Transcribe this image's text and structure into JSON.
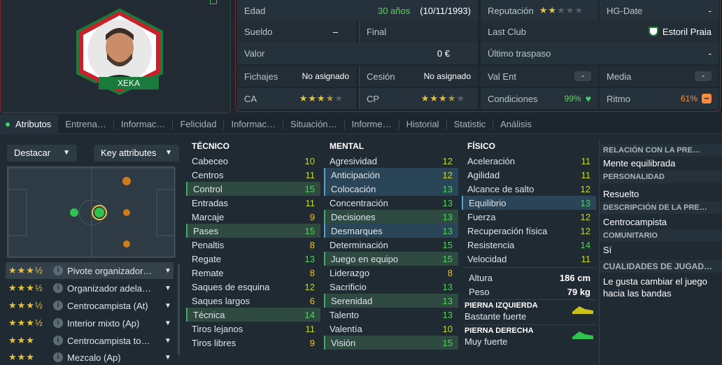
{
  "player": {
    "name": "XEKA"
  },
  "info": {
    "edad_label": "Edad",
    "edad_value": "30 años",
    "birth_date": "(10/11/1993)",
    "reputacion_label": "Reputación",
    "reputacion_stars": "★★☆☆☆",
    "hg_label": "HG-Date",
    "hg_value": "-",
    "sueldo_label": "Sueldo",
    "sueldo_value": "–",
    "final_label": "Final",
    "last_club_label": "Last Club",
    "last_club_value": "Estoril Praia",
    "valor_label": "Valor",
    "valor_value": "0 €",
    "ultimo_label": "Último traspaso",
    "ultimo_value": "-",
    "fichajes_label": "Fichajes",
    "fichajes_value": "No asignado",
    "cesion_label": "Cesión",
    "cesion_value": "No asignado",
    "valent_label": "Val Ent",
    "valent_value": "-",
    "media_label": "Media",
    "media_value": "-",
    "ca_label": "CA",
    "ca_stars": 3.5,
    "cp_label": "CP",
    "cp_stars": 3.5,
    "condiciones_label": "Condiciones",
    "condiciones_value": "99%",
    "ritmo_label": "Ritmo",
    "ritmo_value": "61%",
    "colors": {
      "green": "#5fd35a",
      "orange": "#ff8b3a",
      "accent_red": "#7a2530"
    }
  },
  "tabs": [
    "Atributos",
    "Entrena…",
    "Informac…",
    "Felicidad",
    "Informac…",
    "Situación…",
    "Informe…",
    "Historial",
    "Statistic",
    "Análisis"
  ],
  "left": {
    "destacar": "Destacar",
    "key_attributes": "Key attributes",
    "roles": [
      {
        "stars": "★★★½",
        "name": "Pivote organizador…"
      },
      {
        "stars": "★★★½",
        "name": "Organizador adela…"
      },
      {
        "stars": "★★★½",
        "name": "Centrocampista (At)"
      },
      {
        "stars": "★★★½",
        "name": "Interior mixto (Ap)"
      },
      {
        "stars": "★★★",
        "name": "Centrocampista to…"
      },
      {
        "stars": "★★★",
        "name": "Mezcalo (Ap)"
      }
    ]
  },
  "tecnico": {
    "title": "TÉCNICO",
    "attrs": [
      {
        "n": "Cabeceo",
        "v": "10",
        "hl": ""
      },
      {
        "n": "Centros",
        "v": "11",
        "hl": ""
      },
      {
        "n": "Control",
        "v": "15",
        "hl": "green"
      },
      {
        "n": "Entradas",
        "v": "11",
        "hl": ""
      },
      {
        "n": "Marcaje",
        "v": "9",
        "hl": ""
      },
      {
        "n": "Pases",
        "v": "15",
        "hl": "green"
      },
      {
        "n": "Penaltis",
        "v": "8",
        "hl": ""
      },
      {
        "n": "Regate",
        "v": "13",
        "hl": ""
      },
      {
        "n": "Remate",
        "v": "8",
        "hl": ""
      },
      {
        "n": "Saques de esquina",
        "v": "12",
        "hl": ""
      },
      {
        "n": "Saques largos",
        "v": "6",
        "hl": ""
      },
      {
        "n": "Técnica",
        "v": "14",
        "hl": "green"
      },
      {
        "n": "Tiros lejanos",
        "v": "11",
        "hl": ""
      },
      {
        "n": "Tiros libres",
        "v": "9",
        "hl": ""
      }
    ]
  },
  "mental": {
    "title": "MENTAL",
    "attrs": [
      {
        "n": "Agresividad",
        "v": "12",
        "hl": ""
      },
      {
        "n": "Anticipación",
        "v": "12",
        "hl": "blue"
      },
      {
        "n": "Colocación",
        "v": "13",
        "hl": "blue"
      },
      {
        "n": "Concentración",
        "v": "13",
        "hl": ""
      },
      {
        "n": "Decisiones",
        "v": "13",
        "hl": "green"
      },
      {
        "n": "Desmarques",
        "v": "13",
        "hl": "blue"
      },
      {
        "n": "Determinación",
        "v": "15",
        "hl": ""
      },
      {
        "n": "Juego en equipo",
        "v": "15",
        "hl": "green"
      },
      {
        "n": "Liderazgo",
        "v": "8",
        "hl": ""
      },
      {
        "n": "Sacrificio",
        "v": "13",
        "hl": ""
      },
      {
        "n": "Serenidad",
        "v": "13",
        "hl": "green"
      },
      {
        "n": "Talento",
        "v": "13",
        "hl": ""
      },
      {
        "n": "Valentía",
        "v": "10",
        "hl": ""
      },
      {
        "n": "Visión",
        "v": "15",
        "hl": "green"
      }
    ]
  },
  "fisico": {
    "title": "FÍSICO",
    "attrs": [
      {
        "n": "Aceleración",
        "v": "11",
        "hl": ""
      },
      {
        "n": "Agilidad",
        "v": "11",
        "hl": ""
      },
      {
        "n": "Alcance de salto",
        "v": "12",
        "hl": ""
      },
      {
        "n": "Equilibrio",
        "v": "13",
        "hl": "blue"
      },
      {
        "n": "Fuerza",
        "v": "12",
        "hl": ""
      },
      {
        "n": "Recuperación física",
        "v": "12",
        "hl": ""
      },
      {
        "n": "Resistencia",
        "v": "14",
        "hl": ""
      },
      {
        "n": "Velocidad",
        "v": "11",
        "hl": ""
      }
    ],
    "altura_label": "Altura",
    "altura_value": "186 cm",
    "peso_label": "Peso",
    "peso_value": "79 kg",
    "pierna_izq_label": "PIERNA IZQUIERDA",
    "pierna_izq_value": "Bastante fuerte",
    "pierna_der_label": "PIERNA DERECHA",
    "pierna_der_value": "Muy fuerte"
  },
  "right": {
    "relacion_h": "RELACIÓN CON LA PRE…",
    "relacion_v": "Mente equilibrada",
    "personalidad_h": "PERSONALIDAD",
    "personalidad_v": "Resuelto",
    "descripcion_h": "DESCRIPCIÓN DE LA PRE…",
    "descripcion_v": "Centrocampista",
    "comunitario_h": "COMUNITARIO",
    "comunitario_v": "Sí",
    "cualidades_h": "CUALIDADES DE JUGAD…",
    "cualidades_v1": "Le gusta cambiar el juego",
    "cualidades_v2": "hacia las bandas"
  }
}
